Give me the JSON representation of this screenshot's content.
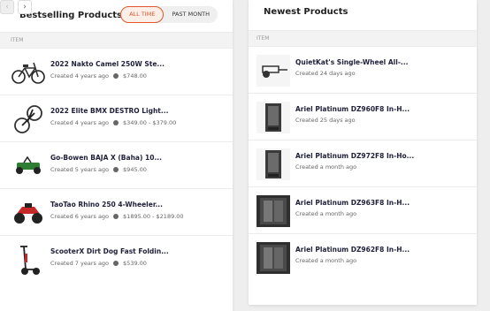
{
  "bestselling": {
    "title": "Bestselling Products",
    "tabs": [
      "ALL TIME",
      "PAST MONTH"
    ],
    "column_header": "ITEM",
    "items": [
      {
        "name": "2022 Nakto Camel 250W Ste...",
        "created": "Created 4 years ago",
        "price": "$748.00",
        "icon": "ebike-icon"
      },
      {
        "name": "2022 Elite BMX DESTRO Light...",
        "created": "Created 4 years ago",
        "price": "$349.00 - $379.00",
        "icon": "bmx-bike-icon"
      },
      {
        "name": "Go-Bowen BAJA X (Baha) 10...",
        "created": "Created 5 years ago",
        "price": "$945.00",
        "icon": "go-kart-icon"
      },
      {
        "name": "TaoTao Rhino 250 4-Wheeler...",
        "created": "Created 6 years ago",
        "price": "$1895.00 - $2189.00",
        "icon": "atv-icon"
      },
      {
        "name": "ScooterX Dirt Dog Fast Foldin...",
        "created": "Created 7 years ago",
        "price": "$539.00",
        "icon": "scooter-icon"
      }
    ],
    "pager": {
      "prev": "‹",
      "next": "›"
    }
  },
  "newest": {
    "title": "Newest Products",
    "column_header": "ITEM",
    "items": [
      {
        "name": "QuietKat's Single-Wheel All-...",
        "created": "Created 24 days ago",
        "icon": "trailer-icon"
      },
      {
        "name": "Ariel Platinum DZ960F8 In-H...",
        "created": "Created 25 days ago",
        "icon": "steam-shower-icon"
      },
      {
        "name": "Ariel Platinum DZ972F8 In-Ho...",
        "created": "Created a month ago",
        "icon": "steam-shower-icon"
      },
      {
        "name": "Ariel Platinum DZ963F8 In-H...",
        "created": "Created a month ago",
        "icon": "steam-shower-icon"
      },
      {
        "name": "Ariel Platinum DZ962F8 In-H...",
        "created": "Created a month ago",
        "icon": "steam-shower-icon"
      }
    ],
    "pager": {
      "prev": "‹",
      "next": "›"
    }
  },
  "colors": {
    "accent": "#e2572b",
    "title": "#1f1f3a"
  }
}
